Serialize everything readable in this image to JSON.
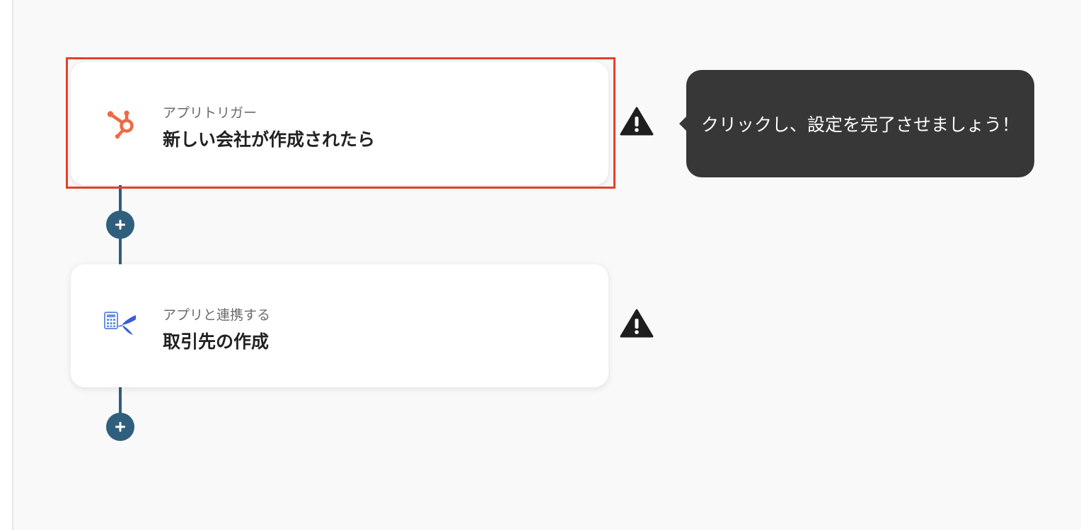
{
  "flow": {
    "steps": [
      {
        "subtitle": "アプリトリガー",
        "title": "新しい会社が作成されたら",
        "icon": "hubspot-icon",
        "icon_color": "#ee6a44",
        "selected": true
      },
      {
        "subtitle": "アプリと連携する",
        "title": "取引先の作成",
        "icon": "freee-accounting-icon",
        "icon_color": "#3a5bd9",
        "selected": false
      }
    ],
    "add_step_icon": "plus-icon"
  },
  "tooltip": {
    "text": "クリックし、設定を完了させましょう！"
  },
  "colors": {
    "connector": "#2f5f7c",
    "highlight": "#e5402a",
    "tooltip_bg": "#373737",
    "warning": "#1e1e1e"
  }
}
